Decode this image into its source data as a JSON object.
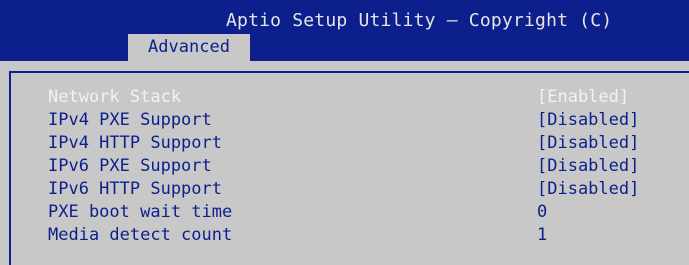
{
  "header": {
    "title": "Aptio Setup Utility – Copyright (C)",
    "active_tab": "Advanced"
  },
  "settings": [
    {
      "label": "Network Stack",
      "value": "[Enabled]",
      "selected": true
    },
    {
      "label": "IPv4 PXE Support",
      "value": "[Disabled]",
      "selected": false
    },
    {
      "label": "IPv4 HTTP Support",
      "value": "[Disabled]",
      "selected": false
    },
    {
      "label": "IPv6 PXE Support",
      "value": "[Disabled]",
      "selected": false
    },
    {
      "label": "IPv6 HTTP Support",
      "value": "[Disabled]",
      "selected": false
    },
    {
      "label": "PXE boot wait time",
      "value": "0",
      "selected": false
    },
    {
      "label": "Media detect count",
      "value": "1",
      "selected": false
    }
  ],
  "colors": {
    "header_bg": "#0c1f8c",
    "body_bg": "#c8c8c8",
    "text": "#0c1f8c",
    "highlight_text": "#f2f2f2"
  }
}
